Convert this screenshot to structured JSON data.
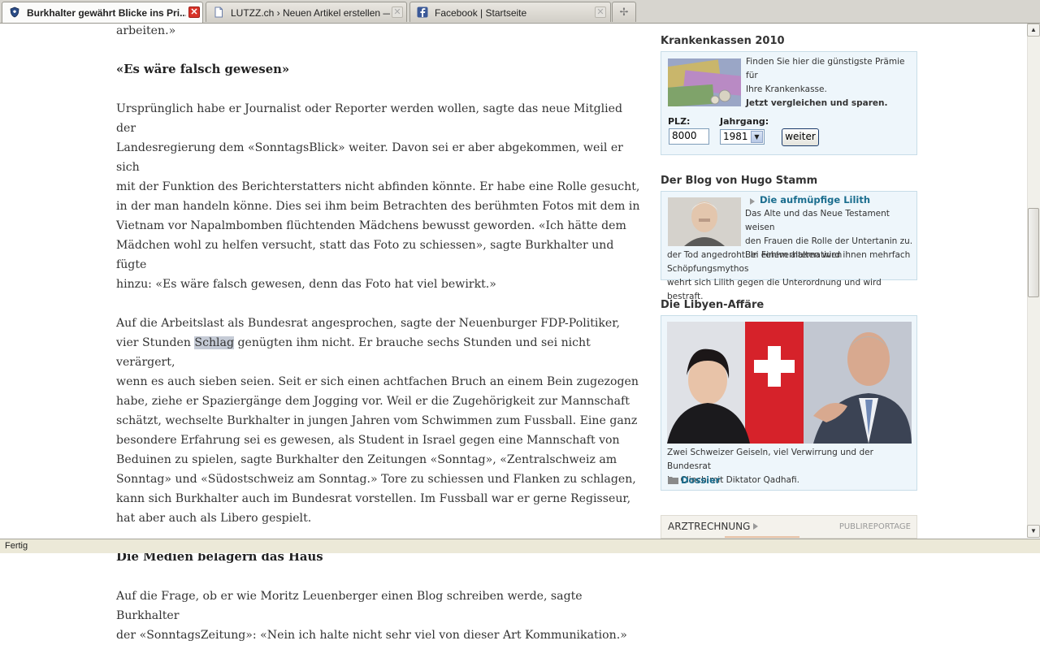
{
  "tabs": [
    {
      "title": "Burkhalter gewährt Blicke ins Pri...",
      "icon": "shield-icon",
      "active": true
    },
    {
      "title": "LUTZZ.ch › Neuen Artikel erstellen — W...",
      "icon": "page-icon",
      "active": false
    },
    {
      "title": "Facebook | Startseite",
      "icon": "facebook-icon",
      "active": false
    }
  ],
  "article": {
    "p0": "arbeiten.»",
    "h1": "«Es wäre falsch gewesen»",
    "p1": [
      "Ursprünglich habe er Journalist oder Reporter werden wollen, sagte das neue Mitglied der",
      "Landesregierung dem «SonntagsBlick» weiter. Davon sei er aber abgekommen, weil er sich",
      "mit der Funktion des Berichterstatters nicht abfinden könnte. Er habe eine Rolle gesucht,",
      "in der man handeln könne. Dies sei ihm beim Betrachten des berühmten Fotos mit dem in",
      "Vietnam vor Napalmbomben flüchtenden Mädchens bewusst geworden. «Ich hätte dem",
      "Mädchen wohl zu helfen versucht, statt das Foto zu schiessen», sagte Burkhalter und fügte",
      "hinzu: «Es wäre falsch gewesen, denn das Foto hat viel bewirkt.»"
    ],
    "p2_line1": "Auf die Arbeitslast als Bundesrat angesprochen, sagte der Neuenburger FDP-Politiker,",
    "p2_line2_pre": "vier Stunden ",
    "p2_highlight": "Schlag",
    "p2_line2_post": " genügten ihm nicht. Er brauche sechs Stunden und sei nicht verärgert,",
    "p2_rest": [
      "wenn es auch sieben seien. Seit er sich einen achtfachen Bruch an einem Bein zugezogen",
      "habe, ziehe er Spaziergänge dem Jogging vor. Weil er die Zugehörigkeit zur Mannschaft",
      "schätzt, wechselte Burkhalter in jungen Jahren vom Schwimmen zum Fussball. Eine ganz",
      "besondere Erfahrung sei es gewesen, als Student in Israel gegen eine Mannschaft von",
      "Beduinen zu spielen, sagte Burkhalter den Zeitungen «Sonntag», «Zentralschweiz am",
      "Sonntag» und «Südostschweiz am Sonntag.» Tore zu schiessen und Flanken zu schlagen,",
      "kann sich Burkhalter auch im Bundesrat vorstellen. Im Fussball war er gerne Regisseur,",
      "hat aber auch als Libero gespielt."
    ],
    "h2": "Die Medien belagern das Haus",
    "p3": [
      "Auf die Frage, ob er wie Moritz Leuenberger einen Blog schreiben werde, sagte Burkhalter",
      "der «SonntagsZeitung»: «Nein ich halte nicht sehr viel von dieser Art Kommunikation.»"
    ]
  },
  "sidebar": {
    "krankenkassen": {
      "title": "Krankenkassen 2010",
      "text1": "Finden Sie hier die günstigste Prämie für",
      "text2": "Ihre Krankenkasse.",
      "text_bold": "Jetzt vergleichen und sparen.",
      "plz_label": "PLZ:",
      "plz_value": "8000",
      "jahrgang_label": "Jahrgang:",
      "jahrgang_value": "1981",
      "button": "weiter"
    },
    "blog": {
      "title": "Der Blog von Hugo Stamm",
      "link": "Die aufmüpfige Lilith",
      "lines": [
        "Das Alte und das Neue Testament weisen",
        "den Frauen die Rolle der Untertanin zu.",
        "Bei Fehlverhalten wird ihnen mehrfach",
        "der Tod angedroht. In einem alternativen Schöpfungsmythos",
        "wehrt sich Lilith gegen die Unterordnung und wird bestraft."
      ]
    },
    "libyen": {
      "title": "Die Libyen-Affäre",
      "caption1": "Zwei Schweizer Geiseln, viel Verwirrung und der Bundesrat",
      "caption2": "im Clinch mit Diktator Qadhafi.",
      "dossier": "Dossier"
    },
    "arzt": {
      "label": "ARZTRECHNUNG",
      "tag": "PUBLIREPORTAGE"
    }
  },
  "status": {
    "text": "Fertig"
  },
  "colors": {
    "link": "#1a6d8e",
    "box_bg": "#eef6fb",
    "box_border": "#c8dde8",
    "close_red": "#d9342a"
  }
}
